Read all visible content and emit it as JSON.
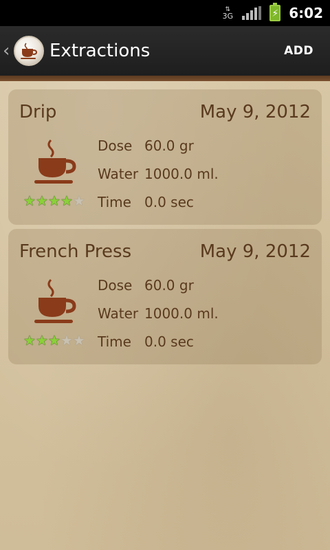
{
  "status_bar": {
    "network": "3G",
    "time": "6:02"
  },
  "action_bar": {
    "title": "Extractions",
    "add_label": "ADD"
  },
  "extractions": [
    {
      "name": "Drip",
      "date": "May 9, 2012",
      "dose_label": "Dose",
      "dose": "60.0 gr",
      "water_label": "Water",
      "water": "1000.0 ml.",
      "time_label": "Time",
      "time": "0.0 sec",
      "rating": 4,
      "rating_max": 5
    },
    {
      "name": "French Press",
      "date": "May 9, 2012",
      "dose_label": "Dose",
      "dose": "60.0 gr",
      "water_label": "Water",
      "water": "1000.0 ml.",
      "time_label": "Time",
      "time": "0.0 sec",
      "rating": 3,
      "rating_max": 5
    }
  ],
  "colors": {
    "text_brown": "#5a3a1e",
    "cup_brown": "#8a3b1a",
    "star_on": "#8bd03a",
    "action_bar": "#222222"
  },
  "icons": {
    "logo": "coffee-cup-icon",
    "card_icon": "coffee-cup-icon",
    "star": "star-icon"
  }
}
